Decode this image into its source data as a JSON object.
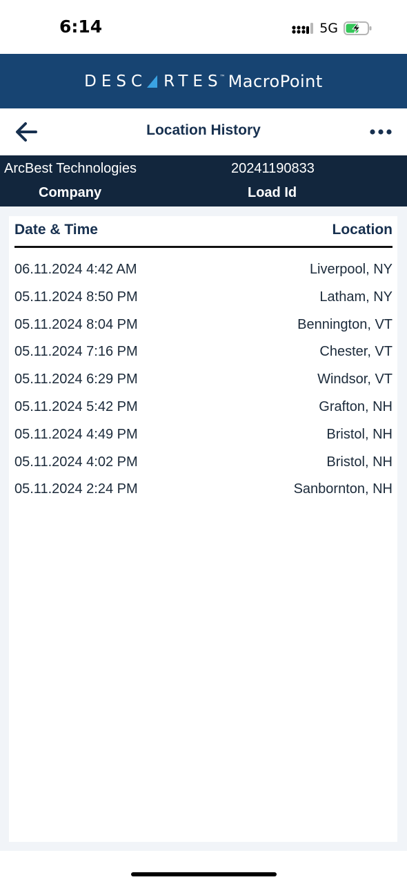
{
  "status_bar": {
    "time": "6:14",
    "network": "5G",
    "battery_level": 0.6,
    "battery_color": "#34c759"
  },
  "brand": {
    "company_word_left": "DESC",
    "company_word_right": "RTES",
    "trademark": "™",
    "product": "MacroPoint",
    "background": "#174472"
  },
  "header": {
    "title": "Location History",
    "back_icon": "arrow-left-icon",
    "more_icon": "more-horizontal-icon"
  },
  "info": {
    "company_value": "ArcBest Technologies",
    "company_label": "Company",
    "load_value": "20241190833",
    "load_label": "Load Id"
  },
  "table": {
    "headers": {
      "date": "Date & Time",
      "location": "Location"
    },
    "rows": [
      {
        "datetime": "06.11.2024 4:42 AM",
        "location": "Liverpool, NY"
      },
      {
        "datetime": "05.11.2024 8:50 PM",
        "location": "Latham, NY"
      },
      {
        "datetime": "05.11.2024 8:04 PM",
        "location": "Bennington, VT"
      },
      {
        "datetime": "05.11.2024 7:16 PM",
        "location": "Chester, VT"
      },
      {
        "datetime": "05.11.2024 6:29 PM",
        "location": "Windsor, VT"
      },
      {
        "datetime": "05.11.2024 5:42 PM",
        "location": "Grafton, NH"
      },
      {
        "datetime": "05.11.2024 4:49 PM",
        "location": "Bristol, NH"
      },
      {
        "datetime": "05.11.2024 4:02 PM",
        "location": "Bristol, NH"
      },
      {
        "datetime": "05.11.2024 2:24 PM",
        "location": "Sanbornton, NH"
      }
    ]
  }
}
